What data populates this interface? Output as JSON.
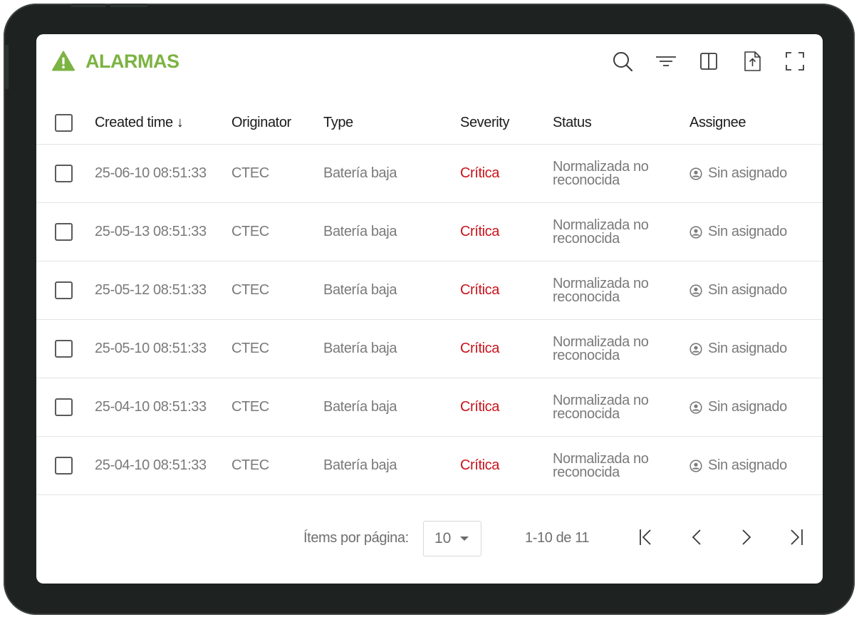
{
  "header": {
    "title": "ALARMAS",
    "icons": [
      "warning-icon",
      "search-icon",
      "filter-icon",
      "columns-icon",
      "export-icon",
      "fullscreen-icon"
    ]
  },
  "colors": {
    "title": "#7cb342",
    "critical": "#c8141b",
    "device_frame": "#1e2322"
  },
  "table": {
    "columns": {
      "created": "Created time ↓",
      "originator": "Originator",
      "type": "Type",
      "severity": "Severity",
      "status": "Status",
      "assignee": "Assignee"
    },
    "rows": [
      {
        "created": "25-06-10 08:51:33",
        "originator": "CTEC",
        "type": "Batería baja",
        "severity": "Crítica",
        "status": "Normalizada no reconocida",
        "assignee": "Sin asignado"
      },
      {
        "created": "25-05-13 08:51:33",
        "originator": "CTEC",
        "type": "Batería baja",
        "severity": "Crítica",
        "status": "Normalizada no reconocida",
        "assignee": "Sin asignado"
      },
      {
        "created": "25-05-12 08:51:33",
        "originator": "CTEC",
        "type": "Batería baja",
        "severity": "Crítica",
        "status": "Normalizada no reconocida",
        "assignee": "Sin asignado"
      },
      {
        "created": "25-05-10 08:51:33",
        "originator": "CTEC",
        "type": "Batería baja",
        "severity": "Crítica",
        "status": "Normalizada no reconocida",
        "assignee": "Sin asignado"
      },
      {
        "created": "25-04-10 08:51:33",
        "originator": "CTEC",
        "type": "Batería baja",
        "severity": "Crítica",
        "status": "Normalizada no reconocida",
        "assignee": "Sin asignado"
      },
      {
        "created": "25-04-10 08:51:33",
        "originator": "CTEC",
        "type": "Batería baja",
        "severity": "Crítica",
        "status": "Normalizada no reconocida",
        "assignee": "Sin asignado"
      }
    ]
  },
  "pagination": {
    "items_per_page_label": "Ítems por página:",
    "items_per_page_value": "10",
    "range_text": "1-10 de 11"
  }
}
